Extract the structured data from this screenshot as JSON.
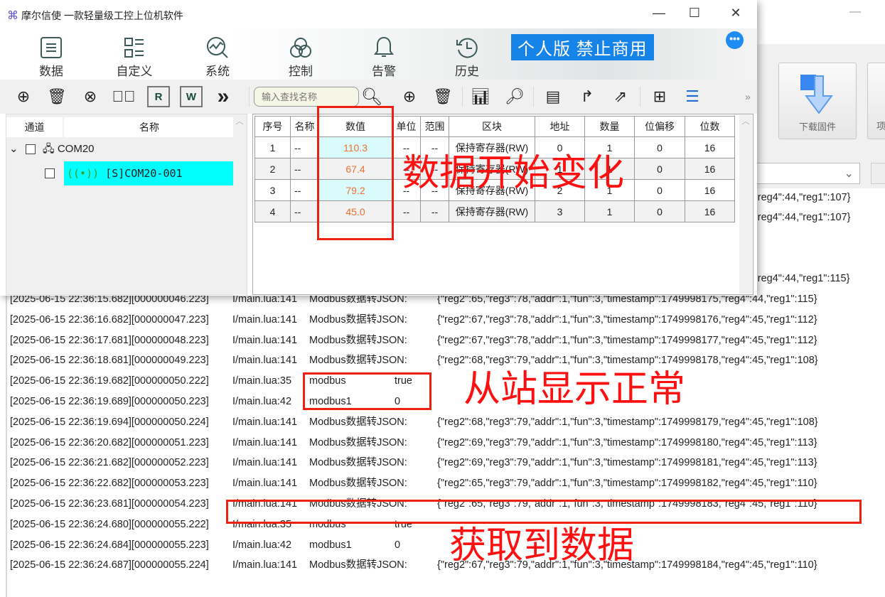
{
  "window": {
    "title": "摩尔信使  一款轻量级工控上位机软件",
    "logo_icon": "command-icon",
    "minimize": "—",
    "maximize": "☐",
    "close": "✕"
  },
  "nav": [
    {
      "label": "数据",
      "icon": "list-icon",
      "active": true
    },
    {
      "label": "自定义",
      "icon": "grid-list-icon"
    },
    {
      "label": "系统",
      "icon": "chart-search-icon"
    },
    {
      "label": "控制",
      "icon": "rings-icon"
    },
    {
      "label": "告警",
      "icon": "bell-icon"
    },
    {
      "label": "历史",
      "icon": "history-icon"
    }
  ],
  "badge": "个人版  禁止商用",
  "more": "•••",
  "search": {
    "placeholder": "输入查找名称"
  },
  "toolbar": {
    "more": "»"
  },
  "tree": {
    "headers": [
      "通道",
      "名称"
    ],
    "channel": "COM20",
    "device": "[S]COM20-001"
  },
  "table": {
    "headers": [
      "序号",
      "名称",
      "数值",
      "单位",
      "范围",
      "区块",
      "地址",
      "数量",
      "位偏移",
      "位数"
    ],
    "rows": [
      [
        "1",
        "--",
        "110.3",
        "--",
        "--",
        "保持寄存器(RW)",
        "0",
        "1",
        "0",
        "16"
      ],
      [
        "2",
        "--",
        "67.4",
        "--",
        "--",
        "保持寄存器(RW)",
        "1",
        "1",
        "0",
        "16"
      ],
      [
        "3",
        "--",
        "79.2",
        "--",
        "--",
        "保持寄存器(RW)",
        "2",
        "1",
        "0",
        "16"
      ],
      [
        "4",
        "--",
        "45.0",
        "--",
        "--",
        "保持寄存器(RW)",
        "3",
        "1",
        "0",
        "16"
      ]
    ]
  },
  "back_window": {
    "button": "下载固件",
    "button2": "项",
    "log_fragments": [
      "'reg4\":44,\"reg1\":107}",
      "'reg4\":44,\"reg1\":107}",
      "'reg4\":44,\"reg1\":115}"
    ]
  },
  "log": [
    [
      "[2025-06-15 22:36:15.682][000000046.223]",
      "I/main.lua:141",
      "Modbus数据转JSON:",
      "",
      "{\"reg2\":65,\"reg3\":78,\"addr\":1,\"fun\":3,\"timestamp\":1749998175,\"reg4\":44,\"reg1\":115}"
    ],
    [
      "[2025-06-15 22:36:16.682][000000047.223]",
      "I/main.lua:141",
      "Modbus数据转JSON:",
      "",
      "{\"reg2\":67,\"reg3\":78,\"addr\":1,\"fun\":3,\"timestamp\":1749998176,\"reg4\":45,\"reg1\":112}"
    ],
    [
      "[2025-06-15 22:36:17.681][000000048.223]",
      "I/main.lua:141",
      "Modbus数据转JSON:",
      "",
      "{\"reg2\":67,\"reg3\":78,\"addr\":1,\"fun\":3,\"timestamp\":1749998177,\"reg4\":45,\"reg1\":112}"
    ],
    [
      "[2025-06-15 22:36:18.681][000000049.223]",
      "I/main.lua:141",
      "Modbus数据转JSON:",
      "",
      "{\"reg2\":68,\"reg3\":79,\"addr\":1,\"fun\":3,\"timestamp\":1749998178,\"reg4\":45,\"reg1\":108}"
    ],
    [
      "[2025-06-15 22:36:19.682][000000050.222]",
      "I/main.lua:35",
      "modbus",
      "true",
      ""
    ],
    [
      "[2025-06-15 22:36:19.689][000000050.223]",
      "I/main.lua:42",
      "modbus1",
      "0",
      ""
    ],
    [
      "[2025-06-15 22:36:19.694][000000050.224]",
      "I/main.lua:141",
      "Modbus数据转JSON:",
      "",
      "{\"reg2\":68,\"reg3\":79,\"addr\":1,\"fun\":3,\"timestamp\":1749998179,\"reg4\":45,\"reg1\":108}"
    ],
    [
      "[2025-06-15 22:36:20.682][000000051.223]",
      "I/main.lua:141",
      "Modbus数据转JSON:",
      "",
      "{\"reg2\":69,\"reg3\":79,\"addr\":1,\"fun\":3,\"timestamp\":1749998180,\"reg4\":45,\"reg1\":113}"
    ],
    [
      "[2025-06-15 22:36:21.682][000000052.223]",
      "I/main.lua:141",
      "Modbus数据转JSON:",
      "",
      "{\"reg2\":69,\"reg3\":79,\"addr\":1,\"fun\":3,\"timestamp\":1749998181,\"reg4\":45,\"reg1\":113}"
    ],
    [
      "[2025-06-15 22:36:22.682][000000053.223]",
      "I/main.lua:141",
      "Modbus数据转JSON:",
      "",
      "{\"reg2\":65,\"reg3\":79,\"addr\":1,\"fun\":3,\"timestamp\":1749998182,\"reg4\":45,\"reg1\":110}"
    ],
    [
      "[2025-06-15 22:36:23.681][000000054.223]",
      "I/main.lua:141",
      "Modbus数据转JSON:",
      "",
      "{\"reg2\":65,\"reg3\":79,\"addr\":1,\"fun\":3,\"timestamp\":1749998183,\"reg4\":45,\"reg1\":110}"
    ],
    [
      "[2025-06-15 22:36:24.680][000000055.222]",
      "I/main.lua:35",
      "modbus",
      "true",
      ""
    ],
    [
      "[2025-06-15 22:36:24.684][000000055.223]",
      "I/main.lua:42",
      "modbus1",
      "0",
      ""
    ],
    [
      "[2025-06-15 22:36:24.687][000000055.224]",
      "I/main.lua:141",
      "Modbus数据转JSON:",
      "",
      "{\"reg2\":67,\"reg3\":79,\"addr\":1,\"fun\":3,\"timestamp\":1749998184,\"reg4\":45,\"reg1\":110}"
    ]
  ],
  "annotations": [
    "数据开始变化",
    "从站显示正常",
    "获取到数据"
  ],
  "colors": {
    "annotation": "#ff1010",
    "value": "#f07030",
    "selected": "#00ffff",
    "badge": "#1683e8"
  }
}
